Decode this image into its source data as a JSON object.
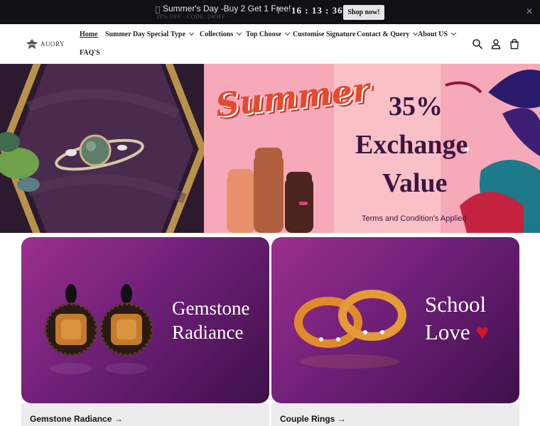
{
  "announcement": {
    "promo": "Summer's Day -Buy 2 Get 1 Free!",
    "code": "20% OFF - CODE: 20OFF",
    "timer": "16 : 13 : 36",
    "shop_label": "Shop now!",
    "close_icon": "close-icon"
  },
  "brand": {
    "name": "AUORY"
  },
  "nav": {
    "items": [
      {
        "label": "Home"
      },
      {
        "label": "Summer Day Special"
      },
      {
        "label": "Type"
      },
      {
        "label": "Collections"
      },
      {
        "label": "Top Choose"
      },
      {
        "label": "Customise Signature"
      },
      {
        "label": "Contact & Query"
      },
      {
        "label": "About US"
      },
      {
        "label": "FAQ'S"
      }
    ]
  },
  "header_icons": [
    "search-icon",
    "account-icon",
    "cart-icon"
  ],
  "hero": {
    "script_title": "Summer",
    "percent": "35%",
    "line1": "Exchange",
    "line2": "Value",
    "terms": "Terms and Condition's  Applied"
  },
  "cards": [
    {
      "title_line1": "Gemstone",
      "title_line2": "Radiance",
      "link": "Gemstone Radiance →"
    },
    {
      "title_line1": "School",
      "title_line2": "Love",
      "link": "Couple Rings →"
    }
  ],
  "colors": {
    "announce_bg": "#0f1116",
    "hero_pink": "#f6a9b8",
    "hero_text": "#3b1540",
    "card_gradient_start": "#9a2f8e",
    "card_gradient_end": "#3f1049"
  }
}
